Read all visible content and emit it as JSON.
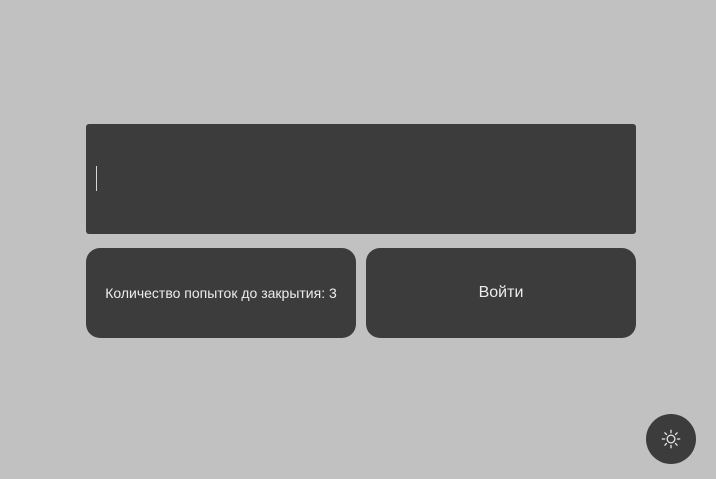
{
  "password_field": {
    "value": "",
    "placeholder": ""
  },
  "attempts_label": "Количество попыток до закрытия: 3",
  "login_button_label": "Войти",
  "theme_toggle_icon": "sun-icon",
  "colors": {
    "background": "#c1c1c1",
    "surface": "#3c3c3c",
    "text": "#ececec"
  }
}
